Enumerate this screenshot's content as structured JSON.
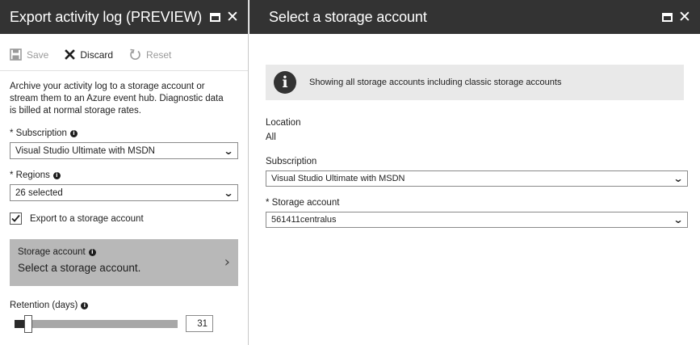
{
  "left_blade": {
    "title": "Export activity log (PREVIEW)",
    "toolbar": {
      "save_label": "Save",
      "discard_label": "Discard",
      "reset_label": "Reset"
    },
    "description": "Archive your activity log to a storage account or stream them to an Azure event hub. Diagnostic data is billed at normal storage rates.",
    "subscription": {
      "label": "* Subscription",
      "value": "Visual Studio Ultimate with MSDN"
    },
    "regions": {
      "label": "* Regions",
      "value": "26 selected"
    },
    "export_checkbox": {
      "label": "Export to a storage account",
      "checked": true
    },
    "storage_tile": {
      "label": "Storage account",
      "value": "Select a storage account."
    },
    "retention": {
      "label": "Retention (days)",
      "value": "31",
      "fraction": 0.06
    }
  },
  "right_blade": {
    "title": "Select a storage account",
    "banner_text": "Showing all storage accounts including classic storage accounts",
    "location_label": "Location",
    "location_value": "All",
    "subscription_label": "Subscription",
    "subscription_value": "Visual Studio Ultimate with MSDN",
    "storage_label": "* Storage account",
    "storage_value": "561411centralus"
  },
  "colors": {
    "header_bg": "#333333",
    "tile_bg": "#b8b8b8",
    "banner_bg": "#e9e9e9"
  }
}
